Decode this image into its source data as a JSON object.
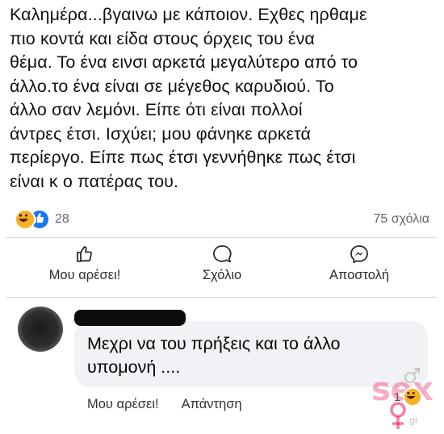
{
  "post": {
    "lines": [
      "Καλημέρα...βγαινω με κάποιον. Εχθες ηρθαμε",
      "πιο κοντά και είδα στους όρχεις του ένα",
      "θέμα. Το ένα εινσι αρκετά μεγαλύτερο από το",
      "άλλο.το ένα είναι σε μέγεθος καρυδιού. Το",
      "άλλο σαν λεμόνι. Είπε ότι είναι πολλοί",
      "άντρες έτσι. Ισχύει; μου φάνηκε αρκετά",
      "περίεργο. Είπε πως έτσι γεννήθηκε πως έτσι",
      "είναι κ ο πατέρας του."
    ],
    "reaction_count": "28",
    "comments_count": "75 σχόλια"
  },
  "actions": {
    "like_label": "Μου αρέσει!",
    "comment_label": "Σχόλιο",
    "send_label": "Αποστολή"
  },
  "comment": {
    "lines": [
      "Μεχρι να του πρήξεις και το άλλο",
      "υπομονή ...."
    ],
    "like_label": "Μου αρέσει!",
    "reply_label": "Απάντηση",
    "reaction_count": "1"
  },
  "watermark": {
    "text": "sex",
    "sub": ".gr"
  },
  "colors": {
    "like_blue": "#1877f2",
    "haha_yellow": "#f7b125",
    "bubble_gray": "#f0f2f5",
    "watermark_pink": "#ec145c"
  }
}
